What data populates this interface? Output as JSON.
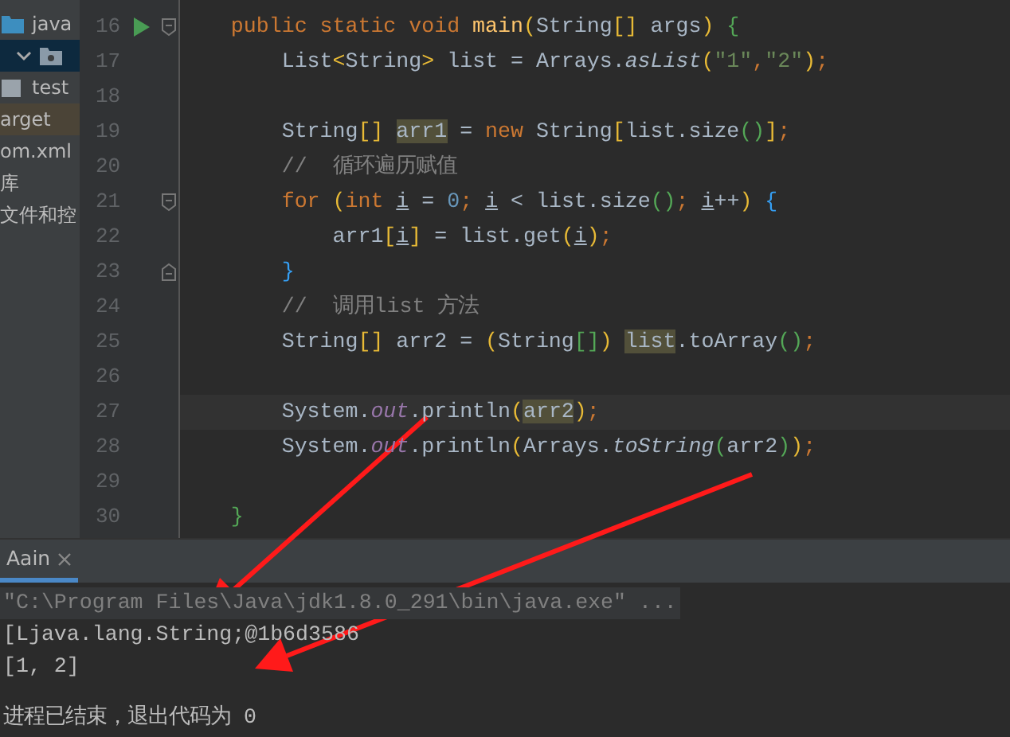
{
  "project_tree": {
    "items": [
      {
        "label": "java",
        "kind": "folder",
        "selected": false,
        "highlighted": false
      },
      {
        "kind": "package",
        "selected": true,
        "highlighted": false
      },
      {
        "label": "test",
        "kind": "folder-gray",
        "selected": false,
        "highlighted": false
      },
      {
        "label": "arget",
        "kind": "file",
        "selected": false,
        "highlighted": true
      },
      {
        "label": "om.xml",
        "kind": "file",
        "selected": false,
        "highlighted": false
      },
      {
        "label": "库",
        "kind": "file",
        "selected": false,
        "highlighted": false
      },
      {
        "label": "文件和控",
        "kind": "file",
        "selected": false,
        "highlighted": false
      }
    ]
  },
  "editor": {
    "lines": [
      {
        "number": "16",
        "run": true,
        "fold_start": true,
        "fold_end": false,
        "current": false,
        "tokens": [
          {
            "t": "    public static void ",
            "kind": "keyword"
          },
          {
            "t": "main",
            "kind": "method"
          },
          {
            "t": "(",
            "kind": "b1"
          },
          {
            "t": "String",
            "kind": "plain"
          },
          {
            "t": "[]",
            "kind": "b1"
          },
          {
            "t": " args",
            "kind": "plain"
          },
          {
            "t": ")",
            "kind": "b1"
          },
          {
            "t": " {",
            "kind": "b2"
          }
        ]
      },
      {
        "number": "17",
        "run": false,
        "fold_start": false,
        "fold_end": false,
        "current": false,
        "tokens": [
          {
            "t": "        List",
            "kind": "plain"
          },
          {
            "t": "<",
            "kind": "b1"
          },
          {
            "t": "String",
            "kind": "plain"
          },
          {
            "t": ">",
            "kind": "b1"
          },
          {
            "t": " list = Arrays.",
            "kind": "plain"
          },
          {
            "t": "asList",
            "kind": "static"
          },
          {
            "t": "(",
            "kind": "b1"
          },
          {
            "t": "\"1\"",
            "kind": "string"
          },
          {
            "t": ",",
            "kind": "keyword"
          },
          {
            "t": "\"2\"",
            "kind": "string"
          },
          {
            "t": ")",
            "kind": "b1"
          },
          {
            "t": ";",
            "kind": "keyword"
          }
        ]
      },
      {
        "number": "18",
        "run": false,
        "fold_start": false,
        "fold_end": false,
        "current": false
      },
      {
        "number": "19",
        "run": false,
        "fold_start": false,
        "fold_end": false,
        "current": false,
        "tokens": [
          {
            "t": "        String",
            "kind": "plain"
          },
          {
            "t": "[] ",
            "kind": "b1"
          },
          {
            "t": "arr1",
            "kind": "ref"
          },
          {
            "t": " = ",
            "kind": "plain"
          },
          {
            "t": "new",
            "kind": "keyword"
          },
          {
            "t": " String",
            "kind": "plain"
          },
          {
            "t": "[",
            "kind": "b1"
          },
          {
            "t": "list.size",
            "kind": "plain"
          },
          {
            "t": "()",
            "kind": "b2"
          },
          {
            "t": "]",
            "kind": "b1"
          },
          {
            "t": ";",
            "kind": "keyword"
          }
        ]
      },
      {
        "number": "20",
        "run": false,
        "fold_start": false,
        "fold_end": false,
        "current": false,
        "tokens": [
          {
            "t": "        //  循环遍历赋值",
            "kind": "comment"
          }
        ]
      },
      {
        "number": "21",
        "run": false,
        "fold_start": true,
        "fold_end": false,
        "current": false,
        "tokens": [
          {
            "t": "        for ",
            "kind": "keyword"
          },
          {
            "t": "(",
            "kind": "b1"
          },
          {
            "t": "int ",
            "kind": "keyword"
          },
          {
            "t": "i",
            "kind": "var"
          },
          {
            "t": " = ",
            "kind": "plain"
          },
          {
            "t": "0",
            "kind": "number"
          },
          {
            "t": "; ",
            "kind": "keyword"
          },
          {
            "t": "i",
            "kind": "var"
          },
          {
            "t": " < list.size",
            "kind": "plain"
          },
          {
            "t": "()",
            "kind": "b2"
          },
          {
            "t": "; ",
            "kind": "keyword"
          },
          {
            "t": "i",
            "kind": "var"
          },
          {
            "t": "++",
            "kind": "plain"
          },
          {
            "t": ")",
            "kind": "b1"
          },
          {
            "t": " {",
            "kind": "b3"
          }
        ]
      },
      {
        "number": "22",
        "run": false,
        "fold_start": false,
        "fold_end": false,
        "current": false,
        "tokens": [
          {
            "t": "            arr1",
            "kind": "plain"
          },
          {
            "t": "[",
            "kind": "b1"
          },
          {
            "t": "i",
            "kind": "var"
          },
          {
            "t": "]",
            "kind": "b1"
          },
          {
            "t": " = list.get",
            "kind": "plain"
          },
          {
            "t": "(",
            "kind": "b1"
          },
          {
            "t": "i",
            "kind": "var"
          },
          {
            "t": ")",
            "kind": "b1"
          },
          {
            "t": ";",
            "kind": "keyword"
          }
        ]
      },
      {
        "number": "23",
        "run": false,
        "fold_start": false,
        "fold_end": true,
        "current": false,
        "tokens": [
          {
            "t": "        }",
            "kind": "b3"
          }
        ]
      },
      {
        "number": "24",
        "run": false,
        "fold_start": false,
        "fold_end": false,
        "current": false,
        "tokens": [
          {
            "t": "        //  调用list 方法",
            "kind": "comment"
          }
        ]
      },
      {
        "number": "25",
        "run": false,
        "fold_start": false,
        "fold_end": false,
        "current": false,
        "tokens": [
          {
            "t": "        String",
            "kind": "plain"
          },
          {
            "t": "[]",
            "kind": "b1"
          },
          {
            "t": " arr2 = ",
            "kind": "plain"
          },
          {
            "t": "(",
            "kind": "b1"
          },
          {
            "t": "String",
            "kind": "plain"
          },
          {
            "t": "[]",
            "kind": "b2"
          },
          {
            "t": ") ",
            "kind": "b1"
          },
          {
            "t": "list",
            "kind": "ref"
          },
          {
            "t": ".toArray",
            "kind": "plain"
          },
          {
            "t": "()",
            "kind": "b2"
          },
          {
            "t": ";",
            "kind": "keyword"
          }
        ]
      },
      {
        "number": "26",
        "run": false,
        "fold_start": false,
        "fold_end": false,
        "current": false
      },
      {
        "number": "27",
        "run": false,
        "fold_start": false,
        "fold_end": false,
        "current": true,
        "tokens": [
          {
            "t": "        System.",
            "kind": "plain"
          },
          {
            "t": "out",
            "kind": "field"
          },
          {
            "t": ".println",
            "kind": "plain"
          },
          {
            "t": "(",
            "kind": "b1"
          },
          {
            "t": "arr2",
            "kind": "ref"
          },
          {
            "t": ")",
            "kind": "b1"
          },
          {
            "t": ";",
            "kind": "keyword"
          }
        ]
      },
      {
        "number": "28",
        "run": false,
        "fold_start": false,
        "fold_end": false,
        "current": false,
        "tokens": [
          {
            "t": "        System.",
            "kind": "plain"
          },
          {
            "t": "out",
            "kind": "field"
          },
          {
            "t": ".println",
            "kind": "plain"
          },
          {
            "t": "(",
            "kind": "b1"
          },
          {
            "t": "Arrays.",
            "kind": "plain"
          },
          {
            "t": "toString",
            "kind": "static"
          },
          {
            "t": "(",
            "kind": "b2"
          },
          {
            "t": "arr2",
            "kind": "plain"
          },
          {
            "t": ")",
            "kind": "b2"
          },
          {
            "t": ")",
            "kind": "b1"
          },
          {
            "t": ";",
            "kind": "keyword"
          }
        ]
      },
      {
        "number": "29",
        "run": false,
        "fold_start": false,
        "fold_end": false,
        "current": false
      },
      {
        "number": "30",
        "run": false,
        "fold_start": false,
        "fold_end": false,
        "current": false,
        "tokens": [
          {
            "t": "    }",
            "kind": "b2"
          }
        ]
      }
    ]
  },
  "run_panel": {
    "tabs": [
      {
        "label": "Aain",
        "selected": true
      }
    ],
    "console": [
      {
        "text": "\"C:\\Program Files\\Java\\jdk1.8.0_291\\bin\\java.exe\" ...",
        "kind": "command"
      },
      {
        "text": "[Ljava.lang.String;@1b6d3586",
        "kind": "output"
      },
      {
        "text": "[1, 2]",
        "kind": "output"
      },
      {
        "kind": "blank"
      },
      {
        "text": "进程已结束，退出代码为 0",
        "kind": "output"
      }
    ]
  }
}
